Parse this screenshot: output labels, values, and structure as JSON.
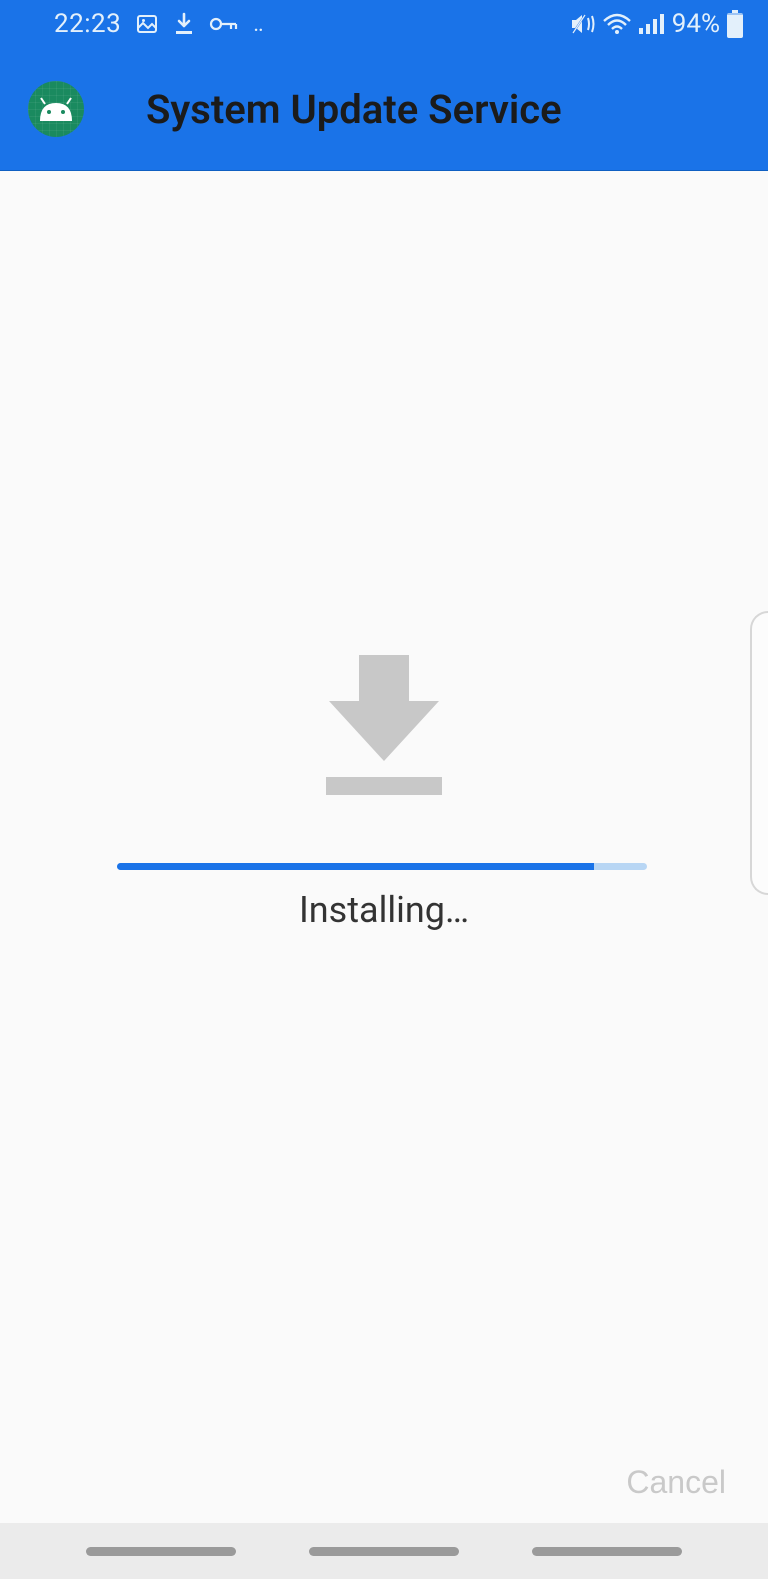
{
  "status_bar": {
    "time": "22:23",
    "battery_pct": "94%"
  },
  "header": {
    "title": "System Update Service"
  },
  "main": {
    "status_text": "Installing…",
    "progress_pct": 90,
    "cancel_label": "Cancel"
  }
}
